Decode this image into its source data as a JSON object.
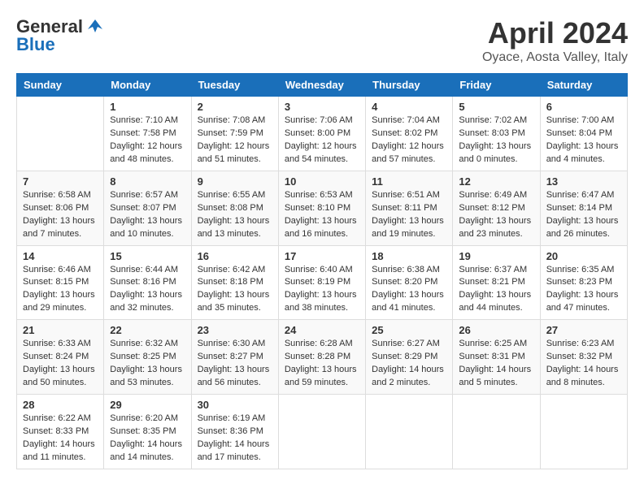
{
  "header": {
    "logo_line1": "General",
    "logo_line2": "Blue",
    "month": "April 2024",
    "location": "Oyace, Aosta Valley, Italy"
  },
  "columns": [
    "Sunday",
    "Monday",
    "Tuesday",
    "Wednesday",
    "Thursday",
    "Friday",
    "Saturday"
  ],
  "weeks": [
    [
      {
        "day": "",
        "lines": []
      },
      {
        "day": "1",
        "lines": [
          "Sunrise: 7:10 AM",
          "Sunset: 7:58 PM",
          "Daylight: 12 hours",
          "and 48 minutes."
        ]
      },
      {
        "day": "2",
        "lines": [
          "Sunrise: 7:08 AM",
          "Sunset: 7:59 PM",
          "Daylight: 12 hours",
          "and 51 minutes."
        ]
      },
      {
        "day": "3",
        "lines": [
          "Sunrise: 7:06 AM",
          "Sunset: 8:00 PM",
          "Daylight: 12 hours",
          "and 54 minutes."
        ]
      },
      {
        "day": "4",
        "lines": [
          "Sunrise: 7:04 AM",
          "Sunset: 8:02 PM",
          "Daylight: 12 hours",
          "and 57 minutes."
        ]
      },
      {
        "day": "5",
        "lines": [
          "Sunrise: 7:02 AM",
          "Sunset: 8:03 PM",
          "Daylight: 13 hours",
          "and 0 minutes."
        ]
      },
      {
        "day": "6",
        "lines": [
          "Sunrise: 7:00 AM",
          "Sunset: 8:04 PM",
          "Daylight: 13 hours",
          "and 4 minutes."
        ]
      }
    ],
    [
      {
        "day": "7",
        "lines": [
          "Sunrise: 6:58 AM",
          "Sunset: 8:06 PM",
          "Daylight: 13 hours",
          "and 7 minutes."
        ]
      },
      {
        "day": "8",
        "lines": [
          "Sunrise: 6:57 AM",
          "Sunset: 8:07 PM",
          "Daylight: 13 hours",
          "and 10 minutes."
        ]
      },
      {
        "day": "9",
        "lines": [
          "Sunrise: 6:55 AM",
          "Sunset: 8:08 PM",
          "Daylight: 13 hours",
          "and 13 minutes."
        ]
      },
      {
        "day": "10",
        "lines": [
          "Sunrise: 6:53 AM",
          "Sunset: 8:10 PM",
          "Daylight: 13 hours",
          "and 16 minutes."
        ]
      },
      {
        "day": "11",
        "lines": [
          "Sunrise: 6:51 AM",
          "Sunset: 8:11 PM",
          "Daylight: 13 hours",
          "and 19 minutes."
        ]
      },
      {
        "day": "12",
        "lines": [
          "Sunrise: 6:49 AM",
          "Sunset: 8:12 PM",
          "Daylight: 13 hours",
          "and 23 minutes."
        ]
      },
      {
        "day": "13",
        "lines": [
          "Sunrise: 6:47 AM",
          "Sunset: 8:14 PM",
          "Daylight: 13 hours",
          "and 26 minutes."
        ]
      }
    ],
    [
      {
        "day": "14",
        "lines": [
          "Sunrise: 6:46 AM",
          "Sunset: 8:15 PM",
          "Daylight: 13 hours",
          "and 29 minutes."
        ]
      },
      {
        "day": "15",
        "lines": [
          "Sunrise: 6:44 AM",
          "Sunset: 8:16 PM",
          "Daylight: 13 hours",
          "and 32 minutes."
        ]
      },
      {
        "day": "16",
        "lines": [
          "Sunrise: 6:42 AM",
          "Sunset: 8:18 PM",
          "Daylight: 13 hours",
          "and 35 minutes."
        ]
      },
      {
        "day": "17",
        "lines": [
          "Sunrise: 6:40 AM",
          "Sunset: 8:19 PM",
          "Daylight: 13 hours",
          "and 38 minutes."
        ]
      },
      {
        "day": "18",
        "lines": [
          "Sunrise: 6:38 AM",
          "Sunset: 8:20 PM",
          "Daylight: 13 hours",
          "and 41 minutes."
        ]
      },
      {
        "day": "19",
        "lines": [
          "Sunrise: 6:37 AM",
          "Sunset: 8:21 PM",
          "Daylight: 13 hours",
          "and 44 minutes."
        ]
      },
      {
        "day": "20",
        "lines": [
          "Sunrise: 6:35 AM",
          "Sunset: 8:23 PM",
          "Daylight: 13 hours",
          "and 47 minutes."
        ]
      }
    ],
    [
      {
        "day": "21",
        "lines": [
          "Sunrise: 6:33 AM",
          "Sunset: 8:24 PM",
          "Daylight: 13 hours",
          "and 50 minutes."
        ]
      },
      {
        "day": "22",
        "lines": [
          "Sunrise: 6:32 AM",
          "Sunset: 8:25 PM",
          "Daylight: 13 hours",
          "and 53 minutes."
        ]
      },
      {
        "day": "23",
        "lines": [
          "Sunrise: 6:30 AM",
          "Sunset: 8:27 PM",
          "Daylight: 13 hours",
          "and 56 minutes."
        ]
      },
      {
        "day": "24",
        "lines": [
          "Sunrise: 6:28 AM",
          "Sunset: 8:28 PM",
          "Daylight: 13 hours",
          "and 59 minutes."
        ]
      },
      {
        "day": "25",
        "lines": [
          "Sunrise: 6:27 AM",
          "Sunset: 8:29 PM",
          "Daylight: 14 hours",
          "and 2 minutes."
        ]
      },
      {
        "day": "26",
        "lines": [
          "Sunrise: 6:25 AM",
          "Sunset: 8:31 PM",
          "Daylight: 14 hours",
          "and 5 minutes."
        ]
      },
      {
        "day": "27",
        "lines": [
          "Sunrise: 6:23 AM",
          "Sunset: 8:32 PM",
          "Daylight: 14 hours",
          "and 8 minutes."
        ]
      }
    ],
    [
      {
        "day": "28",
        "lines": [
          "Sunrise: 6:22 AM",
          "Sunset: 8:33 PM",
          "Daylight: 14 hours",
          "and 11 minutes."
        ]
      },
      {
        "day": "29",
        "lines": [
          "Sunrise: 6:20 AM",
          "Sunset: 8:35 PM",
          "Daylight: 14 hours",
          "and 14 minutes."
        ]
      },
      {
        "day": "30",
        "lines": [
          "Sunrise: 6:19 AM",
          "Sunset: 8:36 PM",
          "Daylight: 14 hours",
          "and 17 minutes."
        ]
      },
      {
        "day": "",
        "lines": []
      },
      {
        "day": "",
        "lines": []
      },
      {
        "day": "",
        "lines": []
      },
      {
        "day": "",
        "lines": []
      }
    ]
  ]
}
